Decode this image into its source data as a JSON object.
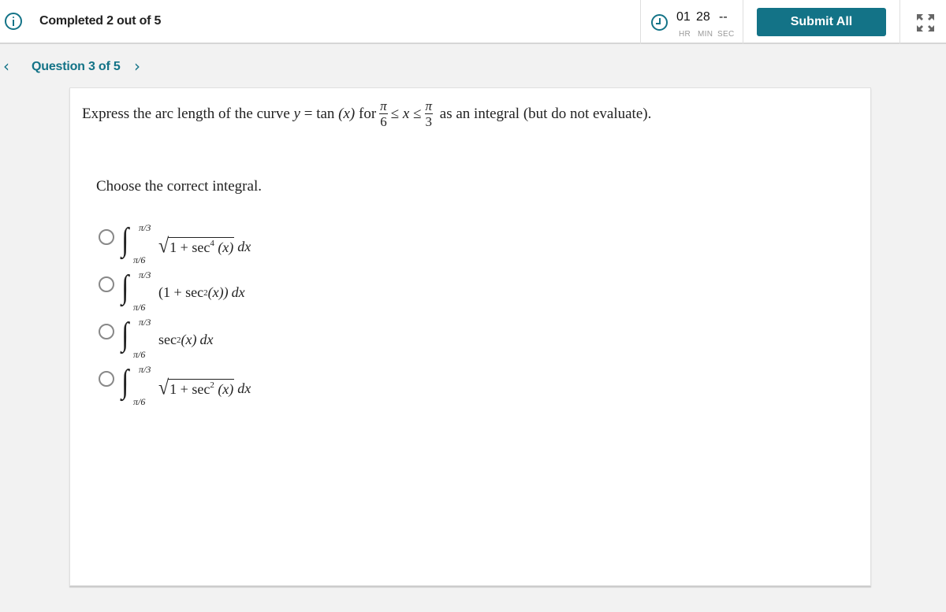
{
  "header": {
    "progress_text": "Completed 2 out of 5",
    "timer": {
      "hours": "01",
      "minutes": "28",
      "seconds": "--",
      "hours_label": "HR",
      "minutes_label": "MIN",
      "seconds_label": "SEC"
    },
    "submit_label": "Submit All",
    "accent_color": "#137387"
  },
  "question_nav": {
    "label": "Question 3 of 5",
    "prev_icon": "chevron-left-icon",
    "next_icon": "chevron-right-icon"
  },
  "question": {
    "prompt_start": "Express the arc length of the curve",
    "curve_var": "y",
    "equals": "=",
    "function": "tan",
    "arg": "(x)",
    "for_word": "for",
    "lower_num": "π",
    "lower_den": "6",
    "ineq1": "≤",
    "var_x": "x",
    "ineq2": "≤",
    "upper_num": "π",
    "upper_den": "3",
    "prompt_end": "as an integral (but do not evaluate).",
    "instruction": "Choose the correct integral.",
    "options": [
      {
        "upper": "π/3",
        "lower": "π/6",
        "has_sqrt": true,
        "body": "1 + sec",
        "power": "4",
        "tail": " (x)",
        "dx": "dx",
        "selected": false
      },
      {
        "upper": "π/3",
        "lower": "π/6",
        "has_sqrt": false,
        "body": "(1 + sec",
        "power": "2",
        "tail": " (x))",
        "dx": "dx",
        "selected": false
      },
      {
        "upper": "π/3",
        "lower": "π/6",
        "has_sqrt": false,
        "body": "sec",
        "power": "2",
        "tail": " (x)",
        "dx": "dx",
        "selected": false
      },
      {
        "upper": "π/3",
        "lower": "π/6",
        "has_sqrt": true,
        "body": "1 + sec",
        "power": "2",
        "tail": " (x)",
        "dx": "dx",
        "selected": false
      }
    ]
  }
}
